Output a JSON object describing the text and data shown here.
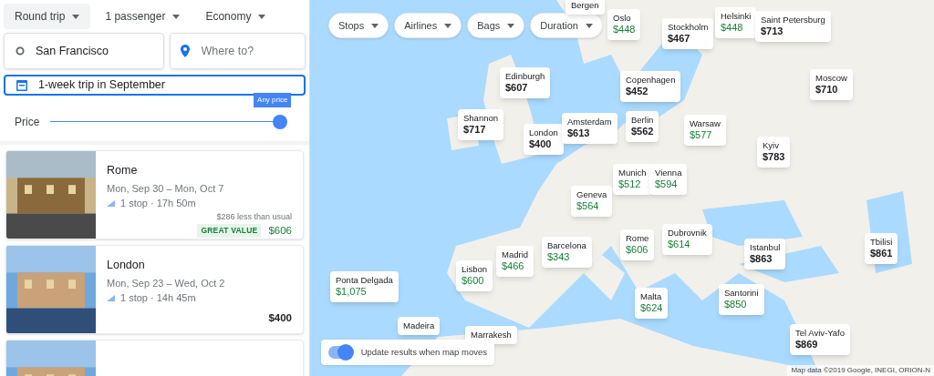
{
  "trip_options": [
    {
      "label": "Round trip",
      "selected": true
    },
    {
      "label": "1 passenger",
      "selected": false
    },
    {
      "label": "Economy",
      "selected": false
    }
  ],
  "origin": {
    "value": "San Francisco"
  },
  "destination": {
    "placeholder": "Where to?"
  },
  "dates": {
    "value": "1-week trip in September",
    "focused": true
  },
  "price_filter": {
    "label": "Price",
    "tooltip": "Any price",
    "level": 1
  },
  "results": [
    {
      "kind": "card",
      "city": "Rome",
      "dates": "Mon, Sep 30 – Mon, Oct 7",
      "flight": "1 stop · 17h 50m",
      "note": "$286 less than usual",
      "badge": "GREAT VALUE",
      "price": "$606",
      "good_price": true
    },
    {
      "kind": "card",
      "city": "London",
      "dates": "Mon, Sep 23 – Wed, Oct 2",
      "flight": "1 stop · 14h 45m",
      "price": "$400",
      "good_price": false
    },
    {
      "kind": "partial"
    }
  ],
  "map": {
    "filters": [
      "Stops",
      "Airlines",
      "Bags",
      "Duration"
    ],
    "pins": [
      {
        "name": "Bergen"
      },
      {
        "name": "Oslo",
        "price": "$448",
        "good_price": true
      },
      {
        "name": "Stockholm",
        "price": "$467",
        "good_price": false
      },
      {
        "name": "Helsinki",
        "price": "$448",
        "good_price": true
      },
      {
        "name": "Saint Petersburg",
        "price": "$713",
        "good_price": false
      },
      {
        "name": "Edinburgh",
        "price": "$607",
        "good_price": false
      },
      {
        "name": "Copenhagen",
        "price": "$452",
        "good_price": false
      },
      {
        "name": "Moscow",
        "price": "$710",
        "good_price": false
      },
      {
        "name": "Shannon",
        "price": "$717",
        "good_price": false
      },
      {
        "name": "London",
        "price": "$400",
        "good_price": false
      },
      {
        "name": "Amsterdam",
        "price": "$613",
        "good_price": false
      },
      {
        "name": "Berlin",
        "price": "$562",
        "good_price": false
      },
      {
        "name": "Warsaw",
        "price": "$577",
        "good_price": true
      },
      {
        "name": "Kyiv",
        "price": "$783",
        "good_price": false
      },
      {
        "name": "Munich",
        "price": "$512",
        "good_price": true
      },
      {
        "name": "Vienna",
        "price": "$594",
        "good_price": true
      },
      {
        "name": "Geneva",
        "price": "$564",
        "good_price": true
      },
      {
        "name": "Dubrovnik",
        "price": "$614",
        "good_price": true
      },
      {
        "name": "Rome",
        "price": "$606",
        "good_price": true
      },
      {
        "name": "Barcelona",
        "price": "$343",
        "good_price": true
      },
      {
        "name": "Madrid",
        "price": "$466",
        "good_price": true
      },
      {
        "name": "Istanbul",
        "price": "$863",
        "good_price": false
      },
      {
        "name": "Tbilisi",
        "price": "$861",
        "good_price": false
      },
      {
        "name": "Lisbon",
        "price": "$600",
        "good_price": true
      },
      {
        "name": "Ponta Delgada",
        "price": "$1,075",
        "good_price": true
      },
      {
        "name": "Malta",
        "price": "$624",
        "good_price": true
      },
      {
        "name": "Santorini",
        "price": "$850",
        "good_price": true
      },
      {
        "name": "Madeira"
      },
      {
        "name": "Marrakesh"
      },
      {
        "name": "Tel Aviv-Yafo",
        "price": "$869",
        "good_price": false
      }
    ],
    "update_toggle": {
      "label": "Update results when map moves",
      "on": true
    },
    "attribution": "Map data ©2019 Google, INEGI, ORION-N"
  }
}
